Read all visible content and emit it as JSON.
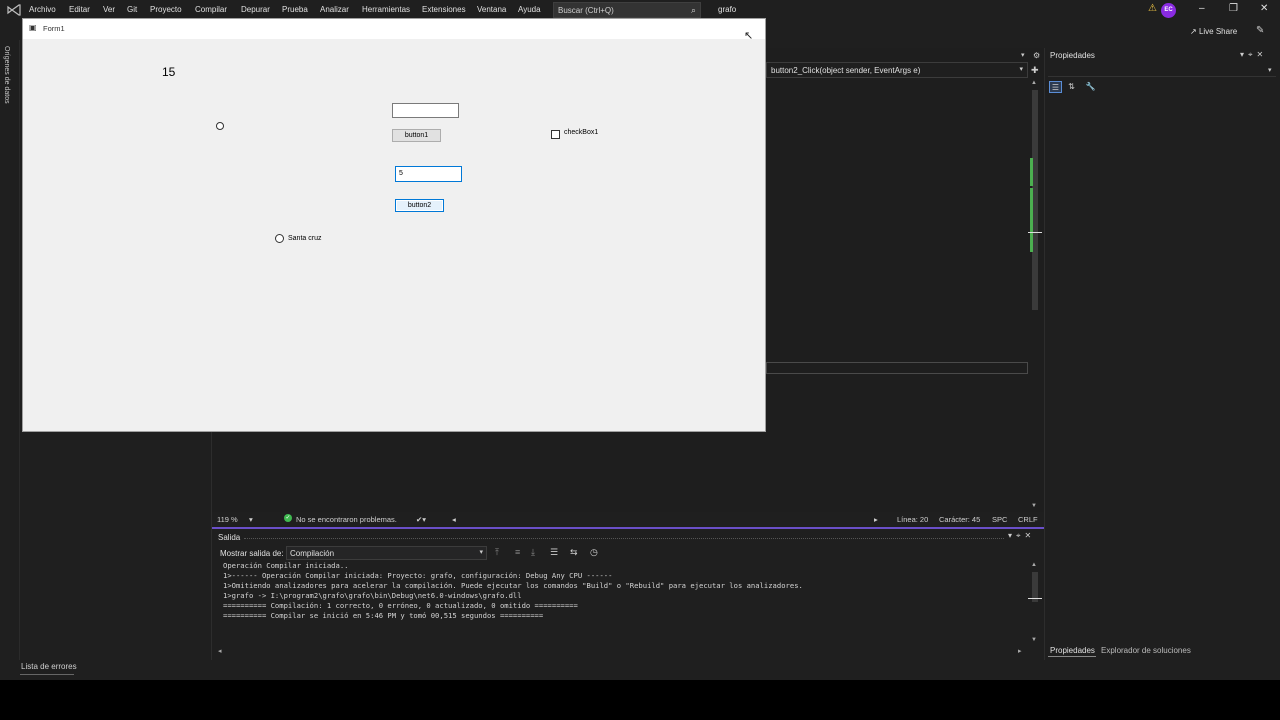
{
  "menubar": {
    "items": [
      "Archivo",
      "Editar",
      "Ver",
      "Git",
      "Proyecto",
      "Compilar",
      "Depurar",
      "Prueba",
      "Analizar",
      "Herramientas",
      "Extensiones",
      "Ventana",
      "Ayuda"
    ],
    "search_placeholder": "Buscar (Ctrl+Q)",
    "solution_name": "grafo",
    "avatar_initials": "EC",
    "live_share": "Live Share"
  },
  "left_panel": {
    "datasource_tab": "Orígenes de datos",
    "errors_tab": "Lista de errores"
  },
  "editor": {
    "nav_member": "button2_Click(object sender, EventArgs e)",
    "zoom": "119 %",
    "issues": "No se encontraron problemas.",
    "line": "Línea: 20",
    "char": "Carácter: 45",
    "spacing": "SPC",
    "line_ending": "CRLF"
  },
  "output": {
    "title": "Salida",
    "show_from_label": "Mostrar salida de:",
    "show_from_value": "Compilación",
    "lines": [
      "Operación Compilar iniciada..",
      "1>------ Operación Compilar iniciada: Proyecto: grafo, configuración: Debug Any CPU ------",
      "1>Omitiendo analizadores para acelerar la compilación. Puede ejecutar los comandos \"Build\" o \"Rebuild\" para ejecutar los analizadores.",
      "1>grafo -> I:\\program2\\grafo\\grafo\\bin\\Debug\\net6.0-windows\\grafo.dll",
      "========== Compilación: 1 correcto, 0 erróneo, 0 actualizado, 0 omitido ==========",
      "========== Compilar se inició en 5:46 PM y tomó 00,515 segundos =========="
    ]
  },
  "properties": {
    "title": "Propiedades",
    "tabs": [
      "Propiedades",
      "Explorador de soluciones"
    ]
  },
  "form1": {
    "title": "Form1",
    "label1": "15",
    "button1": "button1",
    "checkbox1": "checkBox1",
    "textbox2_value": "5",
    "button2": "button2",
    "radio2": "Santa cruz"
  },
  "colors": {
    "vs_bg": "#1f1f1f",
    "accent_purple": "#6a4fc8",
    "ok_green": "#3fb950",
    "form_bg": "#f0f0f0",
    "focus_blue": "#0078d7"
  }
}
